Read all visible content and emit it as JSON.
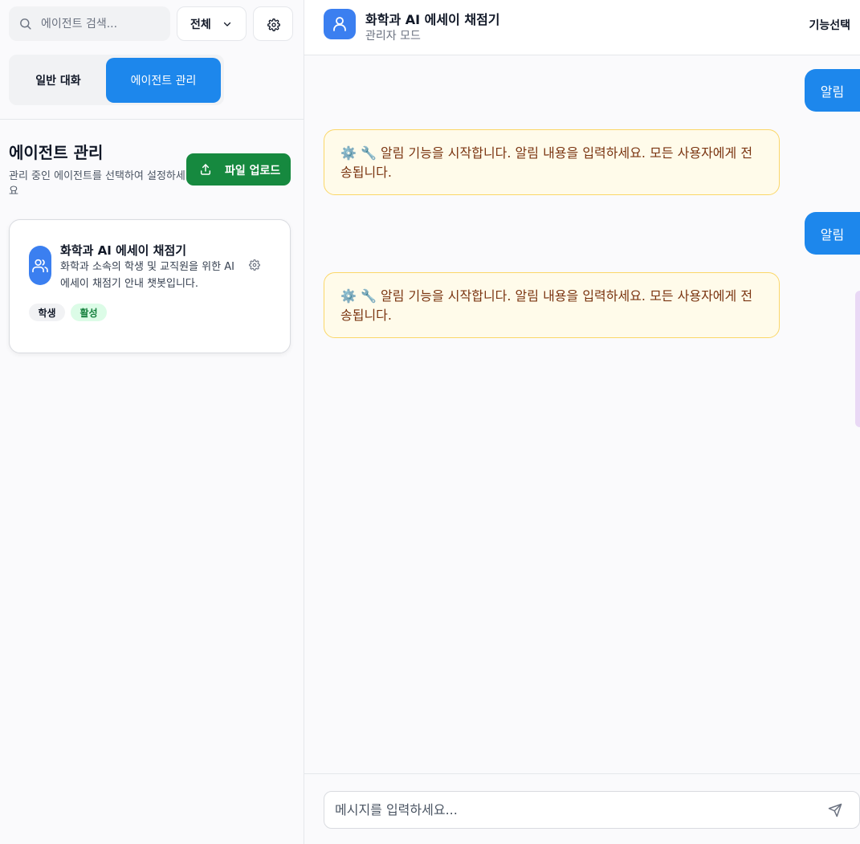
{
  "sidebar": {
    "search": {
      "placeholder": "에이전트 검색..."
    },
    "filter": {
      "selected": "전체"
    },
    "tabs": {
      "chat": "일반 대화",
      "agents": "에이전트 관리"
    },
    "section": {
      "title": "에이전트 관리",
      "description": "관리 중인 에이전트를 선택하여 설정하세요",
      "upload_label": "파일 업로드"
    },
    "agents": [
      {
        "name": "화학과 AI 에세이 채점기",
        "description": "화학과 소속의 학생 및 교직원을 위한 AI 에세이 채점기 안내 챗봇입니다.",
        "role": "학생",
        "status": "활성"
      }
    ]
  },
  "header": {
    "title": "화학과 AI 에세이 채점기",
    "subtitle": "관리자 모드",
    "feature_button": "기능선택"
  },
  "messages": [
    {
      "role": "user",
      "text": "알림"
    },
    {
      "role": "bot",
      "text": "⚙️ 🔧 알림 기능을 시작합니다. 알림 내용을 입력하세요. 모든 사용자에게 전송됩니다."
    },
    {
      "role": "user",
      "text": "알림"
    },
    {
      "role": "bot",
      "text": "⚙️ 🔧 알림 기능을 시작합니다. 알림 내용을 입력하세요. 모든 사용자에게 전송됩니다."
    }
  ],
  "composer": {
    "placeholder": "메시지를 입력하세요..."
  },
  "colors": {
    "accent": "#1d87ec",
    "upload": "#16893f",
    "bot_bubble_bg": "#fffbea",
    "bot_bubble_border": "#fbd768",
    "bot_text": "#7a3410",
    "active_badge_bg": "#dcfce7",
    "active_badge_text": "#15803d"
  }
}
